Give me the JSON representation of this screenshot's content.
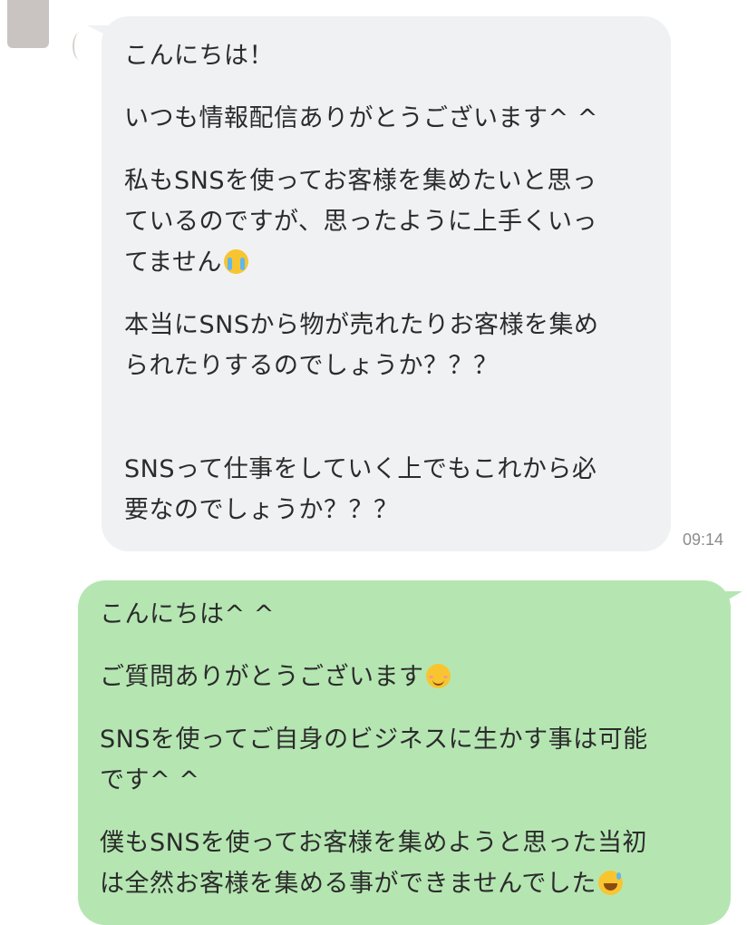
{
  "messages": [
    {
      "sender": "other",
      "time": "09:14",
      "paragraphs": [
        {
          "lines": [
            "こんにちは！"
          ]
        },
        {
          "lines": [
            "いつも情報配信ありがとうございます^ ^"
          ]
        },
        {
          "lines": [
            "私もSNSを使ってお客様を集めたいと思っ",
            "ているのですが、思ったように上手くいっ",
            "てません"
          ],
          "trailing_emoji": "loudly-crying-face-emoji"
        },
        {
          "lines": [
            "本当にSNSから物が売れたりお客様を集め",
            "られたりするのでしょうか？？？"
          ]
        },
        {
          "lines": [
            "SNSって仕事をしていく上でもこれから必",
            "要なのでしょうか？？？"
          ]
        }
      ]
    },
    {
      "sender": "me",
      "paragraphs": [
        {
          "lines": [
            "こんにちは^ ^"
          ]
        },
        {
          "lines": [
            "ご質問ありがとうございます"
          ],
          "trailing_emoji": "smiling-face-emoji"
        },
        {
          "lines": [
            "SNSを使ってご自身のビジネスに生かす事は可能",
            "です^ ^"
          ]
        },
        {
          "lines": [
            "僕もSNSを使ってお客様を集めようと思った当初",
            "は全然お客様を集める事ができませんでした"
          ],
          "trailing_emoji": "grinning-sweat-emoji"
        }
      ]
    }
  ]
}
